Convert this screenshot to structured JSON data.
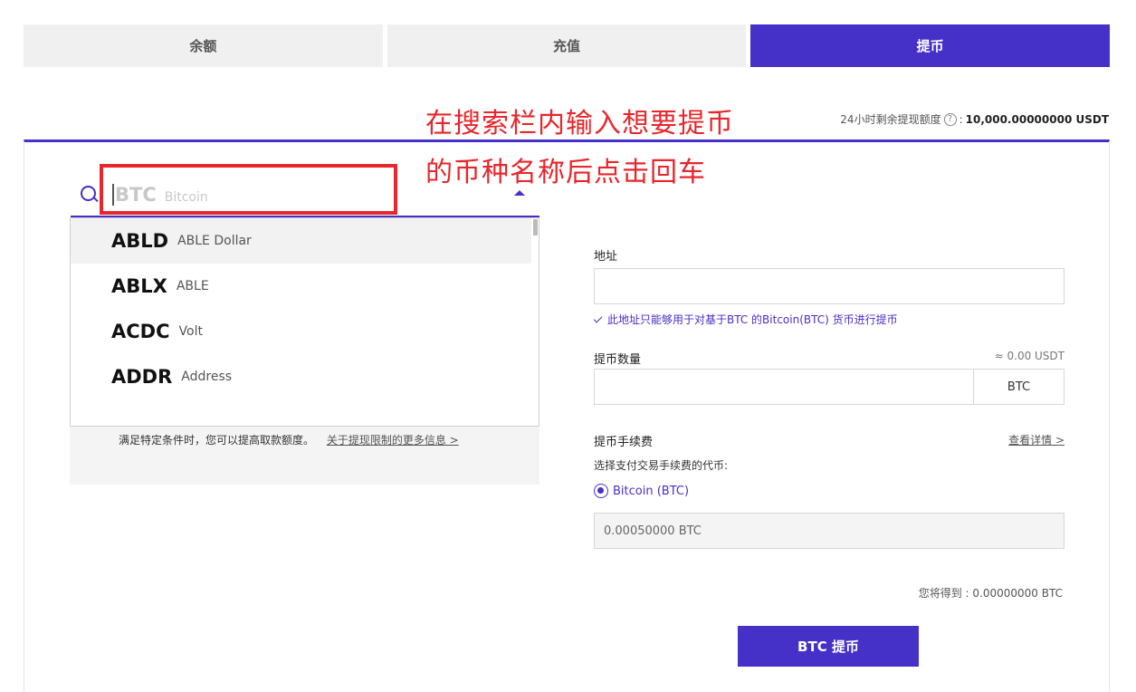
{
  "tabs": [
    {
      "label": "余额"
    },
    {
      "label": "充值"
    },
    {
      "label": "提币"
    }
  ],
  "limit": {
    "prefix": "24小时剩余提现额度",
    "sep": ":",
    "amount": "10,000.00000000 USDT"
  },
  "annotation": {
    "line1": "在搜索栏内输入想要提币",
    "line2": "的币种名称后点击回车"
  },
  "search": {
    "symbol_placeholder": "BTC",
    "name_placeholder": "Bitcoin"
  },
  "dropdown": {
    "items": [
      {
        "symbol": "ABLD",
        "name": "ABLE Dollar"
      },
      {
        "symbol": "ABLX",
        "name": "ABLE"
      },
      {
        "symbol": "ACDC",
        "name": "Volt"
      },
      {
        "symbol": "ADDR",
        "name": "Address"
      }
    ]
  },
  "info": {
    "text": "满足特定条件时，您可以提高取款额度。",
    "link": "关于提现限制的更多信息 >"
  },
  "form": {
    "address_label": "地址",
    "address_note": "此地址只能够用于对基于BTC 的Bitcoin(BTC) 货币进行提币",
    "qty_label": "提币数量",
    "qty_approx": "≈ 0.00 USDT",
    "qty_unit": "BTC",
    "fee_label": "提币手续费",
    "fee_link": "查看详情 >",
    "fee_choose": "选择支付交易手续费的代币:",
    "fee_option": "Bitcoin (BTC)",
    "fee_value": "0.00050000 BTC",
    "receive_label": "您将得到 :",
    "receive_value": "0.00000000 BTC",
    "submit": "BTC 提币"
  },
  "colors": {
    "accent": "#4530c8",
    "annotation": "#e8262b"
  }
}
